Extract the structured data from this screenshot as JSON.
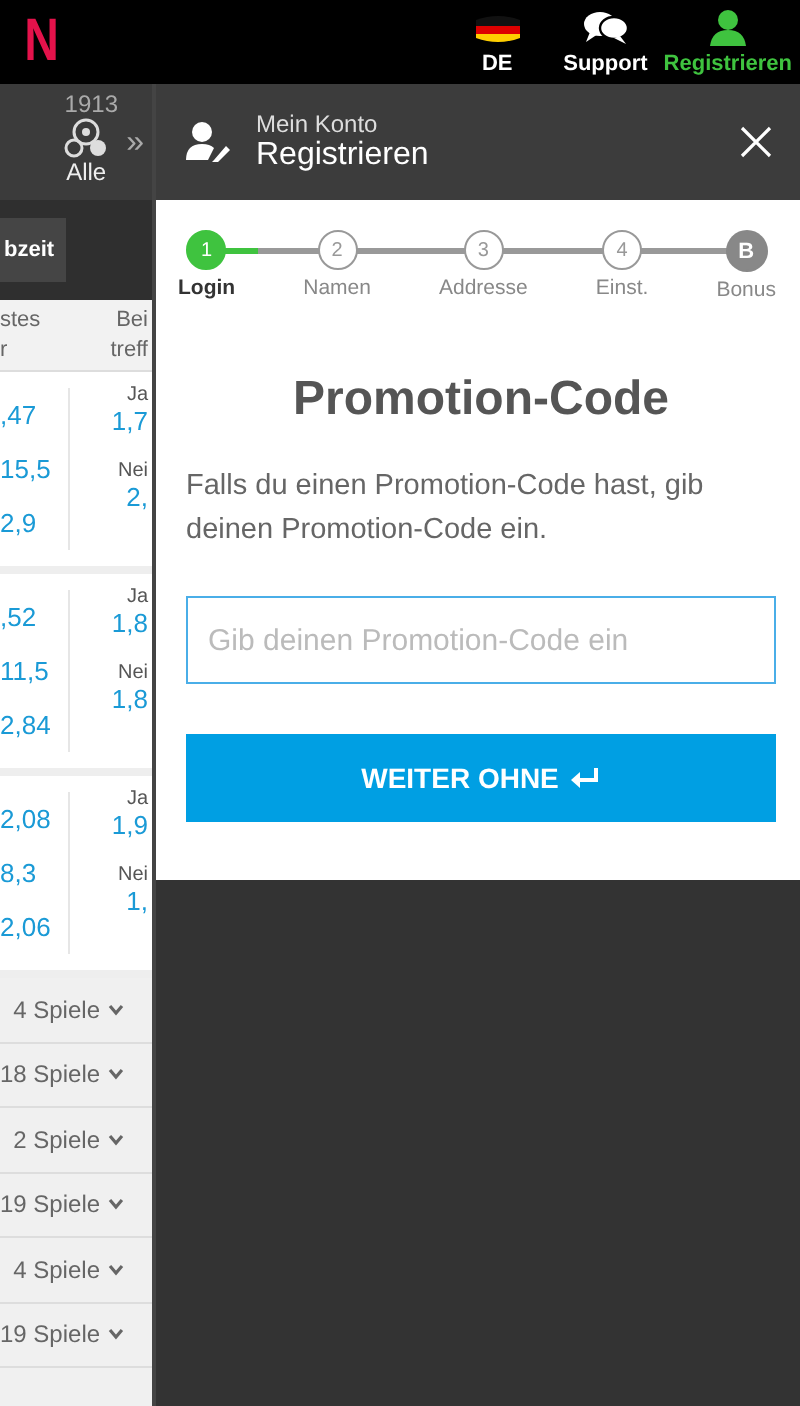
{
  "topbar": {
    "logo": "N",
    "items": [
      {
        "label": "DE",
        "kind": "flag",
        "selected": false
      },
      {
        "label": "Support",
        "kind": "chat",
        "selected": false
      },
      {
        "label": "Registrieren",
        "kind": "user",
        "selected": true
      }
    ]
  },
  "background": {
    "filter": {
      "count": "1913",
      "label": "Alle",
      "more": "»"
    },
    "button": "bzeit",
    "columns": [
      {
        "lines": [
          "stes",
          "r"
        ]
      },
      {
        "lines": [
          "Bei",
          "treff"
        ]
      }
    ],
    "matches": [
      {
        "odds": [
          ",47",
          "15,5",
          "2,9"
        ],
        "both": [
          {
            "label": "Ja",
            "odd": "1,7"
          },
          {
            "label": "Nei",
            "odd": "2,"
          }
        ]
      },
      {
        "odds": [
          ",52",
          "11,5",
          "2,84"
        ],
        "both": [
          {
            "label": "Ja",
            "odd": "1,8"
          },
          {
            "label": "Nei",
            "odd": "1,8"
          }
        ]
      },
      {
        "odds": [
          "2,08",
          "8,3",
          "2,06"
        ],
        "both": [
          {
            "label": "Ja",
            "odd": "1,9"
          },
          {
            "label": "Nei",
            "odd": "1,"
          }
        ]
      }
    ],
    "groups": [
      {
        "count": "4 Spiele"
      },
      {
        "count": "18 Spiele"
      },
      {
        "count": "2 Spiele"
      },
      {
        "count": "19 Spiele"
      },
      {
        "count": "4 Spiele"
      },
      {
        "count": "19 Spiele"
      }
    ]
  },
  "dialog": {
    "subtitle": "Mein Konto",
    "title": "Registrieren",
    "steps": [
      {
        "marker": "1",
        "label": "Login",
        "kind": "number",
        "selected": true
      },
      {
        "marker": "2",
        "label": "Namen",
        "kind": "number",
        "selected": false
      },
      {
        "marker": "3",
        "label": "Addresse",
        "kind": "number",
        "selected": false
      },
      {
        "marker": "4",
        "label": "Einst.",
        "kind": "number",
        "selected": false
      },
      {
        "marker": "B",
        "label": "Bonus",
        "kind": "bonus",
        "selected": false
      }
    ],
    "heading": "Promotion-Code",
    "text": "Falls du einen Promotion-Code hast, gib deinen Promotion-Code ein.",
    "input": {
      "placeholder": "Gib deinen Promotion-Code ein"
    },
    "button": "WEITER OHNE"
  }
}
